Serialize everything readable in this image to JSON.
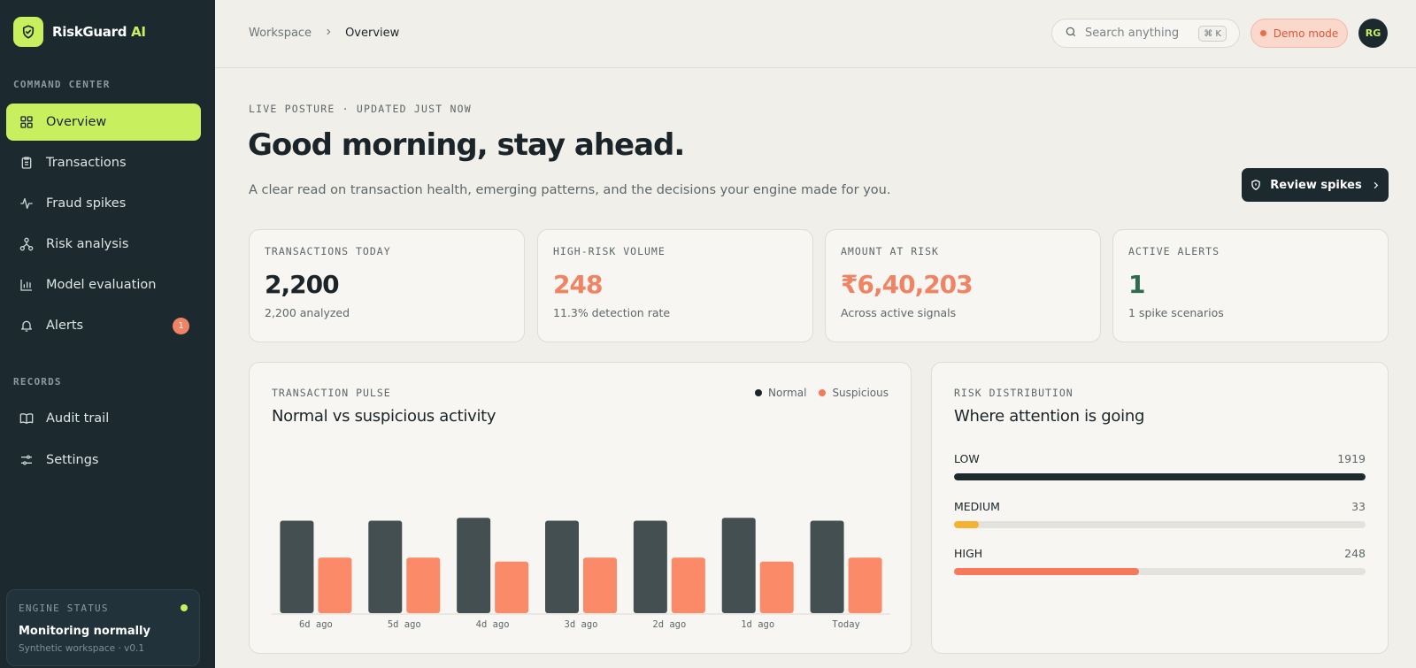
{
  "brand": {
    "name": "RiskGuard",
    "suffix": " AI"
  },
  "sidebar": {
    "section_command": "COMMAND CENTER",
    "section_records": "RECORDS",
    "items": [
      {
        "label": "Overview",
        "icon": "grid-icon",
        "active": true
      },
      {
        "label": "Transactions",
        "icon": "clipboard-icon"
      },
      {
        "label": "Fraud spikes",
        "icon": "activity-icon"
      },
      {
        "label": "Risk analysis",
        "icon": "network-icon"
      },
      {
        "label": "Model evaluation",
        "icon": "bar-chart-icon"
      },
      {
        "label": "Alerts",
        "icon": "bell-icon",
        "badge": "1"
      }
    ],
    "records": [
      {
        "label": "Audit trail",
        "icon": "book-icon"
      },
      {
        "label": "Settings",
        "icon": "sliders-icon"
      }
    ],
    "engine": {
      "label": "ENGINE STATUS",
      "status": "Monitoring normally",
      "sub": "Synthetic workspace · v0.1"
    }
  },
  "header": {
    "breadcrumb_root": "Workspace",
    "breadcrumb_current": "Overview",
    "search_placeholder": "Search anything",
    "shortcut": "⌘ K",
    "demo": "Demo mode",
    "avatar": "RG"
  },
  "hero": {
    "eyebrow": "LIVE POSTURE · UPDATED JUST NOW",
    "title": "Good morning, stay ahead.",
    "subtitle": "A clear read on transaction health, emerging patterns, and the decisions your engine made for you.",
    "cta": "Review spikes"
  },
  "stats": [
    {
      "label": "TRANSACTIONS TODAY",
      "value": "2,200",
      "sub": "2,200 analyzed",
      "color": "#1b2428"
    },
    {
      "label": "HIGH-RISK VOLUME",
      "value": "248",
      "sub": "11.3% detection rate",
      "color": "#f08364"
    },
    {
      "label": "AMOUNT AT RISK",
      "value": "₹6,40,203",
      "sub": "Across active signals",
      "color": "#f08364"
    },
    {
      "label": "ACTIVE ALERTS",
      "value": "1",
      "sub": "1 spike scenarios",
      "color": "#2f6b4f"
    }
  ],
  "pulse": {
    "label": "TRANSACTION PULSE",
    "title": "Normal vs suspicious activity",
    "legend_normal": "Normal",
    "legend_suspicious": "Suspicious"
  },
  "chart_data": {
    "type": "bar",
    "categories": [
      "6d ago",
      "5d ago",
      "4d ago",
      "3d ago",
      "2d ago",
      "1d ago",
      "Today"
    ],
    "series": [
      {
        "name": "Normal",
        "values": [
          95,
          95,
          98,
          95,
          95,
          98,
          95
        ],
        "color": "#434f51"
      },
      {
        "name": "Suspicious",
        "values": [
          57,
          57,
          53,
          57,
          57,
          53,
          57
        ],
        "color": "#fb8a68"
      }
    ],
    "ylim": [
      0,
      100
    ]
  },
  "risk": {
    "label": "RISK DISTRIBUTION",
    "title": "Where attention is going",
    "rows": [
      {
        "name": "LOW",
        "count": "1919",
        "fraction": 1.0,
        "color": "#1c2a30"
      },
      {
        "name": "MEDIUM",
        "count": "33",
        "fraction": 0.06,
        "color": "#f5b12f"
      },
      {
        "name": "HIGH",
        "count": "248",
        "fraction": 0.45,
        "color": "#f5795a"
      }
    ]
  }
}
